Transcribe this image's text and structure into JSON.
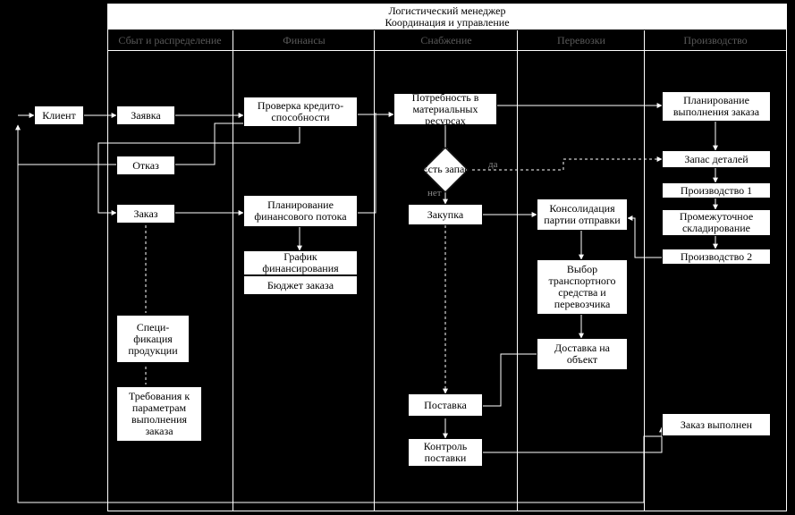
{
  "title": {
    "line1": "Логистический менеджер",
    "line2": "Координация и управление"
  },
  "lanes": {
    "sales": "Сбыт и распределение",
    "finance": "Финансы",
    "supply": "Снабжение",
    "transport": "Перевозки",
    "production": "Производство"
  },
  "boxes": {
    "client": "Клиент",
    "request": "Заявка",
    "refusal": "Отказ",
    "order": "Заказ",
    "spec": "Специ-\nфикация\nпродукции",
    "requirements": "Требования к\nпараметрам\nвыполнения\nзаказа",
    "credit_check": "Проверка кредито-\nспособности",
    "finance_plan": "Планирование\nфинансового потока",
    "finance_schedule": "График\nфинансирования",
    "order_budget": "Бюджет заказа",
    "material_need": "Потребность в\nматериальных ресурсах",
    "stock_decision": "Есть запас",
    "purchase": "Закупка",
    "supply_delivery": "Поставка",
    "supply_control": "Контроль\nпоставки",
    "consolidation": "Консолидация\nпартии отправки",
    "transport_choice": "Выбор\nтранспортного\nсредства и\nперевозчика",
    "site_delivery": "Доставка на\nобъект",
    "order_plan": "Планирование\nвыполнения заказа",
    "parts_stock": "Запас деталей",
    "production1": "Производство 1",
    "storage": "Промежуточное\nскладирование",
    "production2": "Производство 2",
    "order_done": "Заказ выполнен"
  },
  "edge_labels": {
    "yes": "да",
    "no": "нет"
  }
}
